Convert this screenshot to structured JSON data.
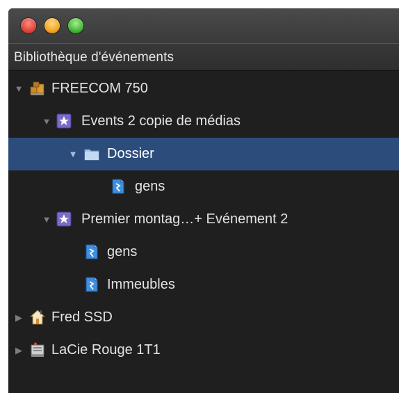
{
  "window": {
    "buttons": {
      "close": "close",
      "minimize": "minimize",
      "zoom": "zoom"
    },
    "colors": {
      "background": "#1f1f1f",
      "selection": "#2c4d7c",
      "text": "#e3e3e3"
    }
  },
  "header": {
    "title": "Bibliothèque d'événements"
  },
  "tree": {
    "items": [
      {
        "label": "FREECOM 750",
        "icon": "drive-boxes-icon",
        "expanded": true,
        "level": 0
      },
      {
        "label": "Events 2 copie de médias",
        "icon": "event-star-icon",
        "expanded": true,
        "level": 1
      },
      {
        "label": "Dossier",
        "icon": "folder-icon",
        "expanded": true,
        "level": 2,
        "selected": true
      },
      {
        "label": "gens",
        "icon": "clip-icon",
        "level": 3
      },
      {
        "label": "Premier montag…+ Evénement 2",
        "icon": "event-star-icon",
        "expanded": true,
        "level": 1
      },
      {
        "label": "gens",
        "icon": "clip-icon",
        "level": 2
      },
      {
        "label": "Immeubles",
        "icon": "clip-icon",
        "level": 2
      },
      {
        "label": "Fred SSD",
        "icon": "home-drive-icon",
        "expanded": false,
        "level": 0
      },
      {
        "label": "LaCie Rouge 1T1",
        "icon": "disk-drive-icon",
        "expanded": false,
        "level": 0
      }
    ]
  }
}
